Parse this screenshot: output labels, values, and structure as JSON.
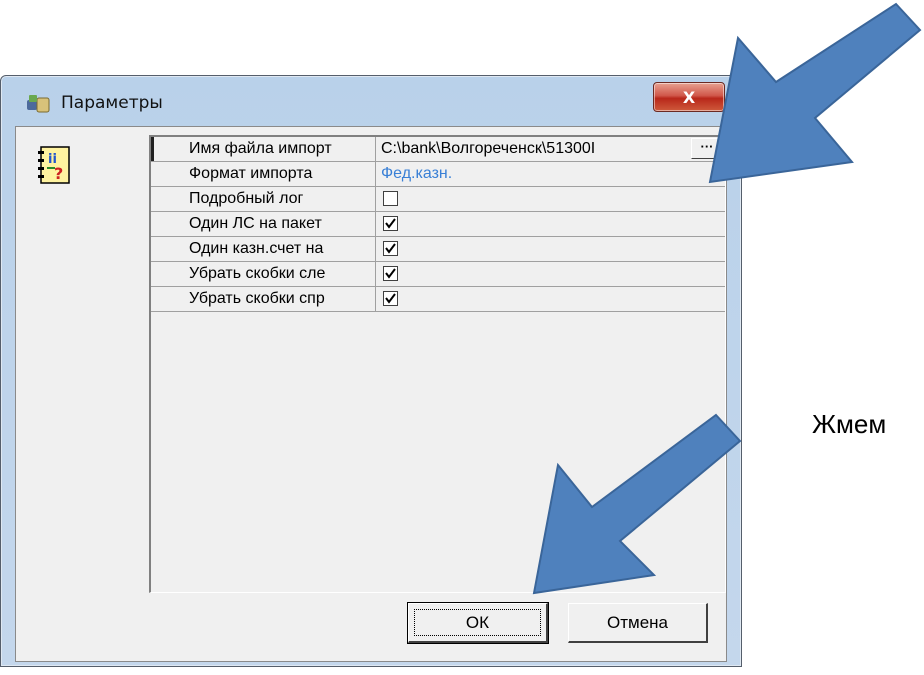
{
  "dialog": {
    "title": "Параметры",
    "close_label": "X"
  },
  "grid": {
    "rows": [
      {
        "key": "Имя файла импорт",
        "value": "C:\\bank\\Волгореченск\\51300I",
        "kind": "path",
        "button": "···"
      },
      {
        "key": "Формат импорта",
        "value": "Фед.казн.",
        "kind": "link"
      },
      {
        "key": "Подробный лог",
        "checked": false,
        "kind": "checkbox"
      },
      {
        "key": "Один ЛС на пакет",
        "checked": true,
        "kind": "checkbox"
      },
      {
        "key": "Один казн.счет на",
        "checked": true,
        "kind": "checkbox"
      },
      {
        "key": "Убрать скобки сле",
        "checked": true,
        "kind": "checkbox"
      },
      {
        "key": "Убрать скобки спр",
        "checked": true,
        "kind": "checkbox"
      }
    ]
  },
  "buttons": {
    "ok": "ОК",
    "cancel": "Отмена"
  },
  "caption": "Жмем",
  "colors": {
    "arrow": "#4f81bd",
    "link": "#3a80d6",
    "close": "#c8392a"
  }
}
